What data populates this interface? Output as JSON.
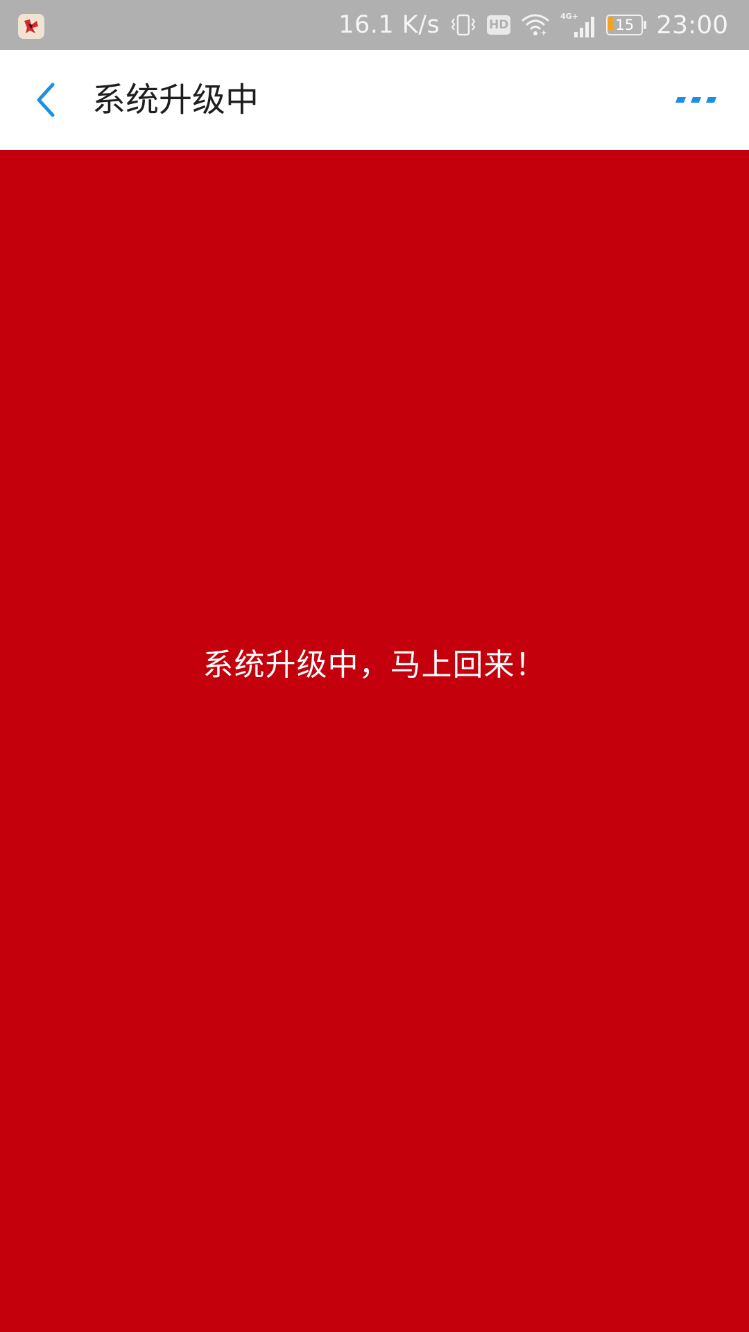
{
  "status_bar": {
    "app_icon": "app-logo-icon",
    "net_speed": "16.1 K/s",
    "icons": [
      "vibrate-icon",
      "hd-icon",
      "wifi-icon",
      "signal-4g-icon",
      "battery-icon"
    ],
    "hd_label": "HD",
    "network_label": "4G+",
    "battery_level": "15",
    "battery_fraction": 0.15,
    "time": "23:00"
  },
  "header": {
    "back_icon": "back-arrow-icon",
    "title": "系统升级中",
    "more_icon": "more-dots-icon"
  },
  "main": {
    "message": "系统升级中，马上回来！"
  },
  "colors": {
    "status_bar_bg": "#b0b0b0",
    "header_bg": "#ffffff",
    "accent_blue": "#1a8fe3",
    "main_bg": "#c4000c",
    "battery_orange": "#f5a31a"
  }
}
